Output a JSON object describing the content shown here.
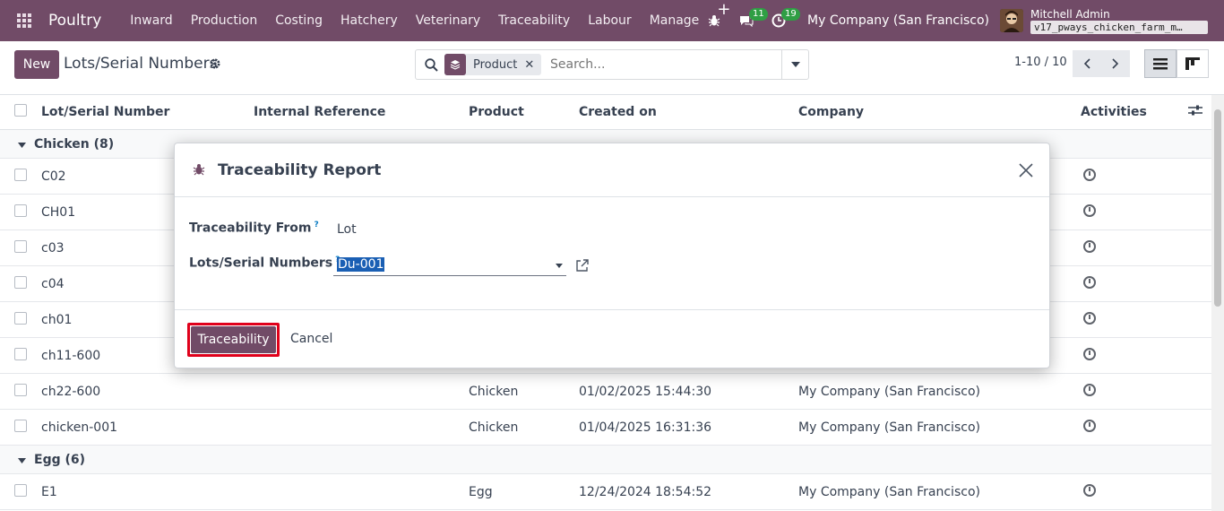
{
  "navbar": {
    "brand": "Poultry",
    "menu": [
      "Inward",
      "Production",
      "Costing",
      "Hatchery",
      "Veterinary",
      "Traceability",
      "Labour",
      "Manage"
    ],
    "messages_count": "11",
    "activities_count": "19",
    "company": "My Company (San Francisco)",
    "user_name": "Mitchell Admin",
    "db_name": "v17_pways_chicken_farm_m…"
  },
  "control": {
    "new_label": "New",
    "title": "Lots/Serial Numbers",
    "facet_label": "Product",
    "search_placeholder": "Search...",
    "pager": "1-10 / 10"
  },
  "list": {
    "headers": {
      "lot": "Lot/Serial Number",
      "internal_ref": "Internal Reference",
      "product": "Product",
      "created_on": "Created on",
      "company": "Company",
      "activities": "Activities"
    },
    "groups": [
      {
        "label": "Chicken (8)"
      },
      {
        "label": "Egg (6)"
      }
    ],
    "rows": [
      {
        "lot": "C02",
        "product": "",
        "created": "",
        "company": ""
      },
      {
        "lot": "CH01",
        "product": "",
        "created": "",
        "company": ""
      },
      {
        "lot": "c03",
        "product": "",
        "created": "",
        "company": ""
      },
      {
        "lot": "c04",
        "product": "",
        "created": "",
        "company": ""
      },
      {
        "lot": "ch01",
        "product": "",
        "created": "",
        "company": ""
      },
      {
        "lot": "ch11-600",
        "product": "",
        "created": "",
        "company": ""
      },
      {
        "lot": "ch22-600",
        "product": "Chicken",
        "created": "01/02/2025 15:44:30",
        "company": "My Company (San Francisco)"
      },
      {
        "lot": "chicken-001",
        "product": "Chicken",
        "created": "01/04/2025 16:31:36",
        "company": "My Company (San Francisco)"
      },
      {
        "lot": "E1",
        "product": "Egg",
        "created": "12/24/2024 18:54:52",
        "company": "My Company (San Francisco)"
      }
    ]
  },
  "modal": {
    "title": "Traceability Report",
    "traceability_from_label": "Traceability From",
    "traceability_from_value": "Lot",
    "lots_label": "Lots/Serial Numbers",
    "lots_value": "Du-001",
    "help_mark": "?",
    "primary_button": "Traceability",
    "cancel_button": "Cancel"
  },
  "colors": {
    "brand": "#714b67",
    "highlight": "#e0001b",
    "badge": "#2f9e44"
  }
}
